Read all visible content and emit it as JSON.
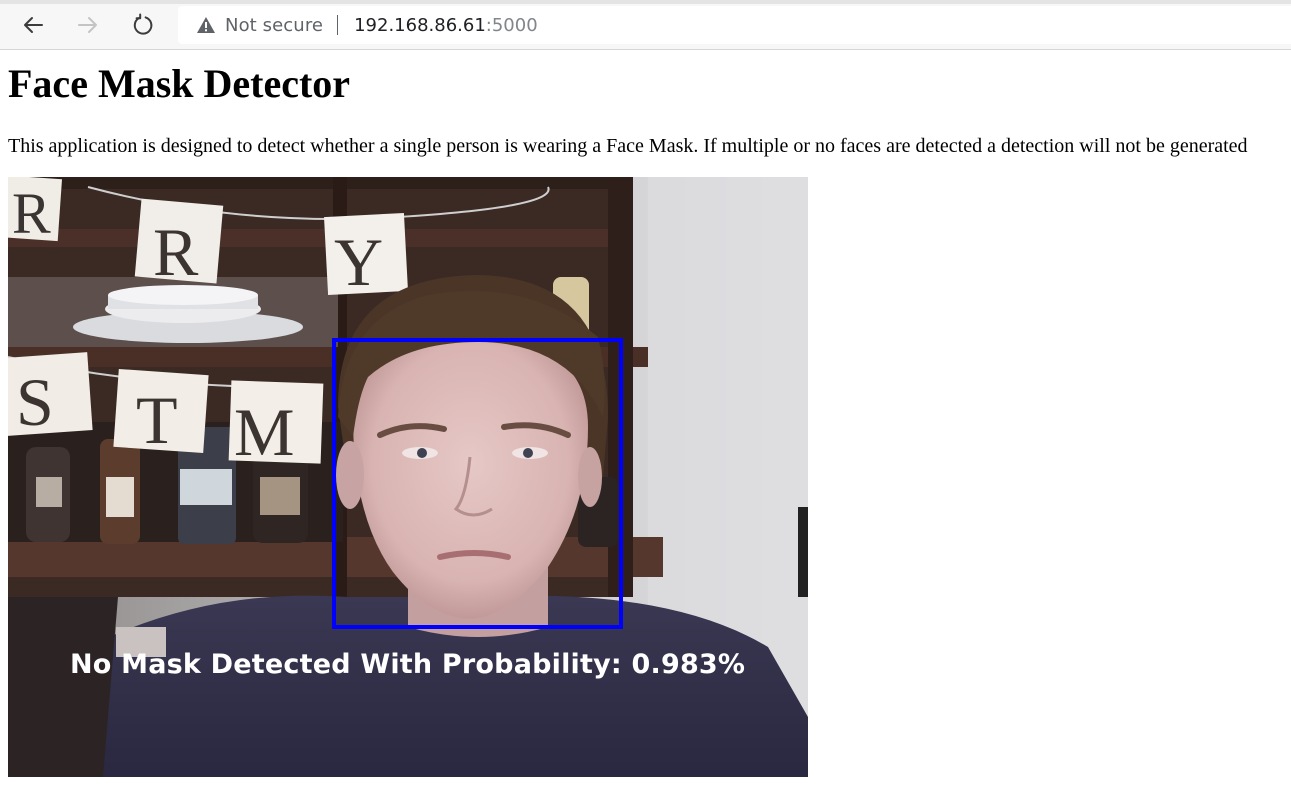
{
  "browser": {
    "security_label": "Not secure",
    "url_host": "192.168.86.61",
    "url_port": ":5000",
    "icons": {
      "back": "arrow-left",
      "forward": "arrow-right",
      "reload": "circular-arrow",
      "security": "warning-triangle"
    }
  },
  "page": {
    "title": "Face Mask Detector",
    "description": "This application is designed to detect whether a single person is wearing a Face Mask. If multiple or no faces are detected a detection will not be generated"
  },
  "video_feed": {
    "banner_letters": [
      "R",
      "R",
      "Y",
      "S",
      "T",
      "M"
    ],
    "detection": {
      "label": "No Mask Detected With Probability: 0.983%",
      "box_color": "#0000ff"
    }
  }
}
